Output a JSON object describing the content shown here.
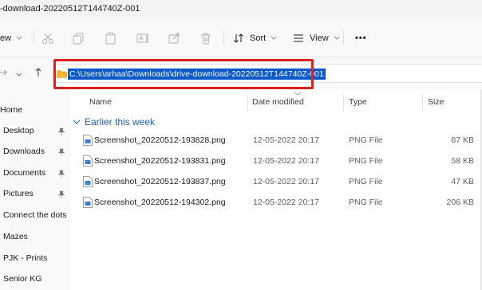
{
  "window": {
    "title": "-download-20220512T144740Z-001"
  },
  "toolbar": {
    "view_fragment": "ew",
    "sort_label": "Sort",
    "view_label": "View",
    "more_label": "•••"
  },
  "address": {
    "path": "C:\\Users\\arhaa\\Downloads\\drive-download-20220512T144740Z-001"
  },
  "sidebar": {
    "items": [
      {
        "label": "Home",
        "pinned": false
      },
      {
        "label": "Desktop",
        "pinned": true
      },
      {
        "label": "Downloads",
        "pinned": true
      },
      {
        "label": "Documents",
        "pinned": true
      },
      {
        "label": "Pictures",
        "pinned": true
      },
      {
        "label": "Connect the dots",
        "pinned": false
      },
      {
        "label": "Mazes",
        "pinned": false
      },
      {
        "label": "PJK - Prints",
        "pinned": false
      },
      {
        "label": "Senior KG",
        "pinned": false
      }
    ]
  },
  "columns": {
    "name": "Name",
    "date": "Date modified",
    "type": "Type",
    "size": "Size"
  },
  "group": {
    "label": "Earlier this week"
  },
  "files": [
    {
      "name": "Screenshot_20220512-193828.png",
      "date": "12-05-2022 20:17",
      "type": "PNG File",
      "size": "87 KB"
    },
    {
      "name": "Screenshot_20220512-193831.png",
      "date": "12-05-2022 20:17",
      "type": "PNG File",
      "size": "58 KB"
    },
    {
      "name": "Screenshot_20220512-193837.png",
      "date": "12-05-2022 20:17",
      "type": "PNG File",
      "size": "47 KB"
    },
    {
      "name": "Screenshot_20220512-194302.png",
      "date": "12-05-2022 20:17",
      "type": "PNG File",
      "size": "206 KB"
    }
  ],
  "colors": {
    "accent": "#0a58c9",
    "highlight": "#e02020",
    "group_label": "#1f5fb8",
    "folder": "#f5b82e"
  }
}
